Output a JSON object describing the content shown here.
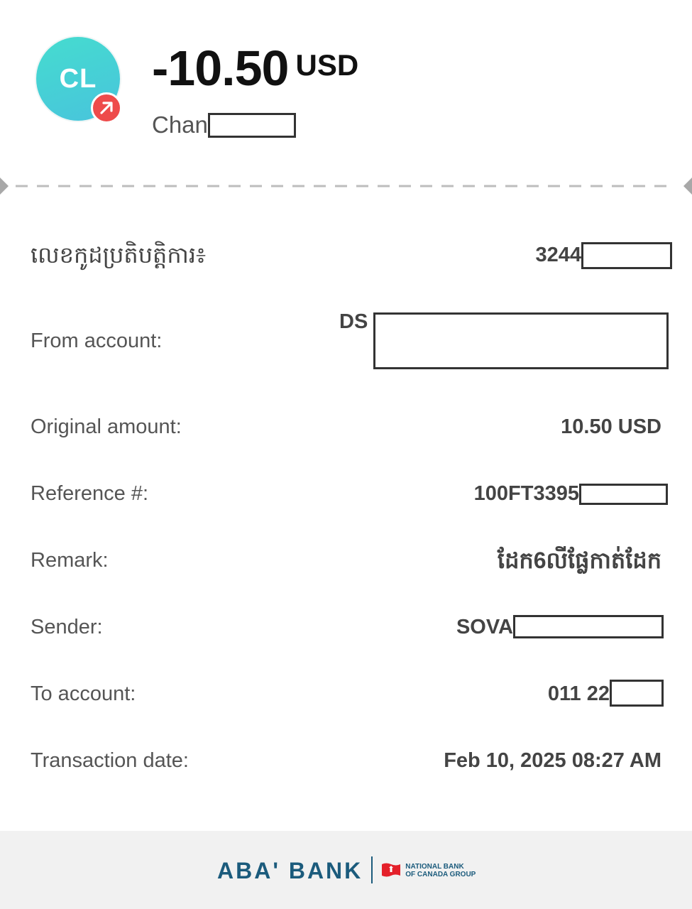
{
  "header": {
    "avatar_initials": "CL",
    "amount": "-10.50",
    "currency": "USD",
    "recipient_name": "Chan"
  },
  "details": {
    "rows": [
      {
        "label": "លេខកូដប្រតិបត្តិការ៖",
        "value": "3244"
      },
      {
        "label": "From account:",
        "value": "DS"
      },
      {
        "label": "Original amount:",
        "value": "10.50 USD"
      },
      {
        "label": "Reference #:",
        "value": "100FT3395"
      },
      {
        "label": "Remark:",
        "value": "ដែក6លីផ្លែកាត់ដែក"
      },
      {
        "label": "Sender:",
        "value": "SOVA"
      },
      {
        "label": "To account:",
        "value": "011 22"
      },
      {
        "label": "Transaction date:",
        "value": "Feb 10, 2025 08:27 AM"
      }
    ]
  },
  "footer": {
    "bank_name": "ABA' BANK",
    "group_line1": "NATIONAL BANK",
    "group_line2": "OF CANADA GROUP"
  },
  "colors": {
    "avatar_gradient_start": "#45dccf",
    "avatar_gradient_end": "#48c4dc",
    "badge": "#ee4b4b",
    "brand_blue": "#1b5b7c",
    "nbc_red": "#e4202a"
  },
  "icons": {
    "badge": "outgoing-arrow-icon",
    "flag": "national-bank-flag-icon"
  }
}
